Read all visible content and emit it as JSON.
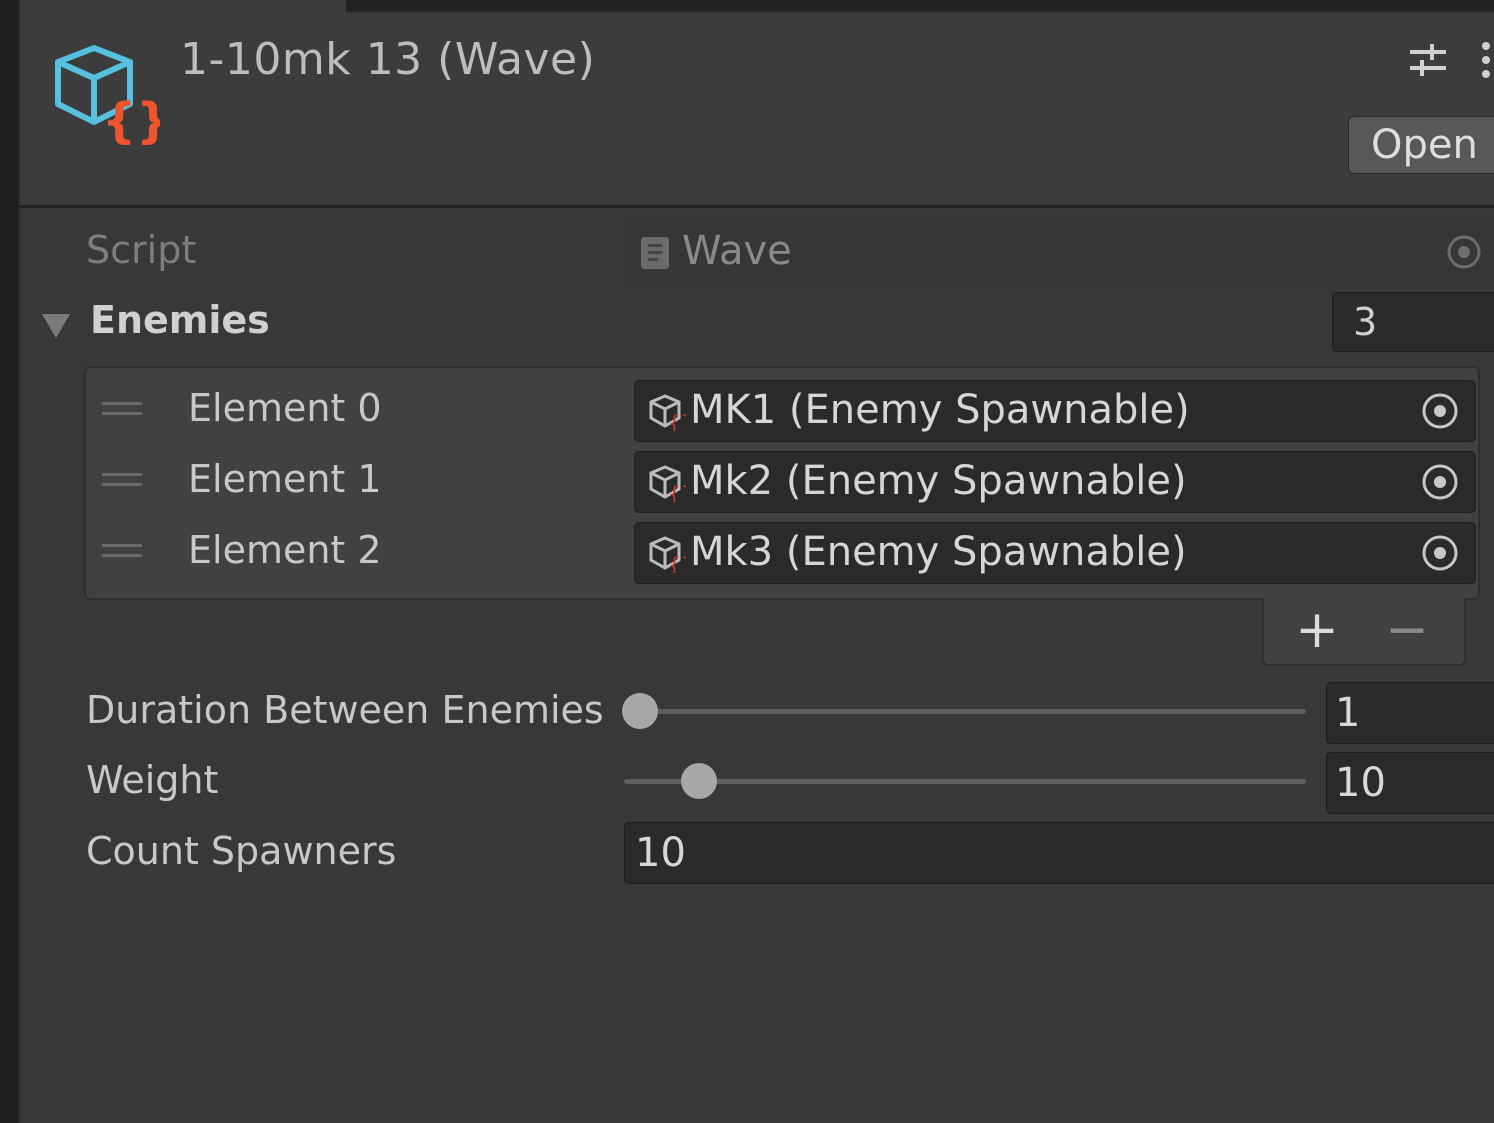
{
  "header": {
    "title": "1-10mk 13 (Wave)",
    "open_label": "Open",
    "icon": "scriptable-object-cube-icon"
  },
  "script": {
    "label": "Script",
    "value": "Wave"
  },
  "enemies": {
    "label": "Enemies",
    "count": "3",
    "items": [
      {
        "label": "Element 0",
        "value": "MK1 (Enemy Spawnable)"
      },
      {
        "label": "Element 1",
        "value": "Mk2 (Enemy Spawnable)"
      },
      {
        "label": "Element 2",
        "value": "Mk3 (Enemy Spawnable)"
      }
    ],
    "add_label": "+",
    "remove_label": "−"
  },
  "duration": {
    "label": "Duration Between Enemies",
    "value": "1",
    "slider_fraction": 0.0
  },
  "weight": {
    "label": "Weight",
    "value": "10",
    "slider_fraction": 0.11
  },
  "count_spawners": {
    "label": "Count Spawners",
    "value": "10"
  },
  "colors": {
    "background": "#383838",
    "field": "#2a2a2a",
    "icon_cube": "#57c0e0",
    "icon_braces": "#f0542c"
  }
}
